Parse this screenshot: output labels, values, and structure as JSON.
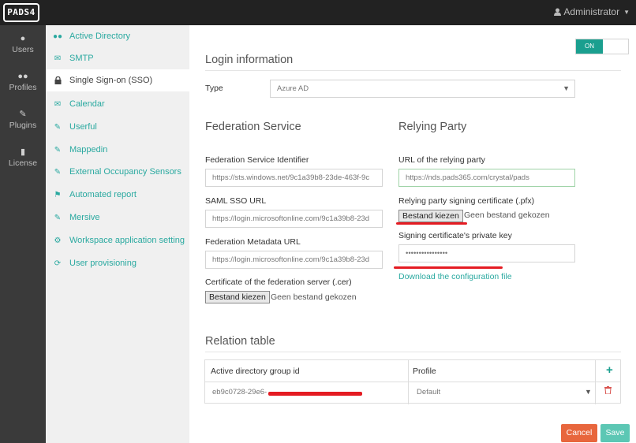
{
  "header": {
    "logo": "PADS4",
    "user_icon": "user-icon",
    "user": "Administrator"
  },
  "rail": [
    {
      "icon": "user-icon",
      "label": "Users"
    },
    {
      "icon": "users-icon",
      "label": "Profiles"
    },
    {
      "icon": "plug-icon",
      "label": "Plugins"
    },
    {
      "icon": "bookmark-icon",
      "label": "License"
    }
  ],
  "submenu": [
    {
      "icon": "users-icon",
      "label": "Active Directory"
    },
    {
      "icon": "envelope-icon",
      "label": "SMTP"
    },
    {
      "icon": "lock-icon",
      "label": "Single Sign-on (SSO)",
      "active": true
    },
    {
      "icon": "envelope-outline-icon",
      "label": "Calendar"
    },
    {
      "icon": "plug-icon",
      "label": "Userful"
    },
    {
      "icon": "plug-icon",
      "label": "Mappedin"
    },
    {
      "icon": "plug-icon",
      "label": "External Occupancy Sensors"
    },
    {
      "icon": "flag-icon",
      "label": "Automated report"
    },
    {
      "icon": "plug-icon",
      "label": "Mersive"
    },
    {
      "icon": "gear-icon",
      "label": "Workspace application setting"
    },
    {
      "icon": "refresh-icon",
      "label": "User provisioning"
    }
  ],
  "toggle": {
    "label": "ON",
    "state": true
  },
  "login": {
    "title": "Login information",
    "type_label": "Type",
    "type_value": "Azure AD"
  },
  "federation": {
    "title": "Federation Service",
    "identifier_label": "Federation Service Identifier",
    "identifier_value": "https://sts.windows.net/9c1a39b8-23de-463f-9c",
    "saml_label": "SAML SSO URL",
    "saml_value": "https://login.microsoftonline.com/9c1a39b8-23d",
    "metadata_label": "Federation Metadata URL",
    "metadata_value": "https://login.microsoftonline.com/9c1a39b8-23d",
    "cert_label": "Certificate of the federation server (.cer)",
    "cert_button": "Bestand kiezen",
    "cert_note": "Geen bestand gekozen"
  },
  "relying": {
    "title": "Relying Party",
    "url_label": "URL of the relying party",
    "url_value": "https://nds.pads365.com/crystal/pads",
    "cert_label": "Relying party signing certificate (.pfx)",
    "cert_button": "Bestand kiezen",
    "cert_note": "Geen bestand gekozen",
    "key_label": "Signing certificate's private key",
    "key_value": "••••••••••••••••",
    "download_link": "Download the configuration file"
  },
  "relation": {
    "title": "Relation table",
    "col_group": "Active directory group id",
    "col_profile": "Profile",
    "row_group": "eb9c0728-29e6-",
    "row_profile": "Default"
  },
  "actions": {
    "cancel": "Cancel",
    "save": "Save"
  },
  "colors": {
    "accent": "#1a9f8f",
    "link": "#2aa9a0",
    "cancel": "#e8663d",
    "save": "#5cc7b4",
    "redaction": "#e41b22"
  }
}
